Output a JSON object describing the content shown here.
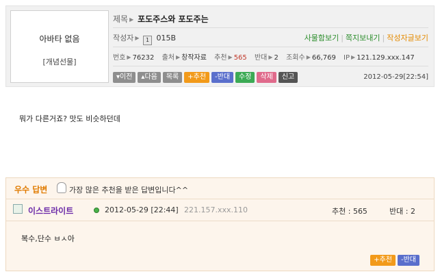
{
  "author_box": {
    "nickname": "아바타 없음",
    "tag": "[개념선물]"
  },
  "post": {
    "title_label": "제목",
    "title": "포도주스와 포도주는",
    "author_label": "작성자",
    "level_icon": "level-icon",
    "author_id": "015B",
    "links": [
      "사물함보기",
      "쪽지보내기",
      "작성자글보기"
    ],
    "meta": {
      "number_label": "번호",
      "number": "76232",
      "source_label": "출처",
      "source": "창작자료",
      "recommend_label": "추천",
      "recommend": "565",
      "oppose_label": "반대",
      "oppose": "2",
      "views_label": "조회수",
      "views": "66,769",
      "ip_label": "IP",
      "ip": "121.129.xxx.147"
    },
    "buttons": {
      "prev": "▾이전",
      "next": "▴다음",
      "list": "목록",
      "recommend": "+추천",
      "oppose": "-반대",
      "edit": "수정",
      "delete": "삭제",
      "report": "신고"
    },
    "datetime": "2012-05-29[22:54]",
    "body": "뭐가 다른거죠? 맛도 비슷하던데"
  },
  "best_answer": {
    "title": "우수 답변",
    "icon": "thumbs-up-icon",
    "description": "가장 많은 추천을 받은 답변입니다^^",
    "user_name": "이스트라이트",
    "datetime": "2012-05-29 [22:44]",
    "ip": "221.157.xxx.110",
    "recommend_text": "추천 : 565",
    "oppose_text": "반대 : 2",
    "content": "복수,단수 ㅂㅅ아",
    "recommend_button": "+추천",
    "oppose_button": "-반대"
  },
  "colors": {
    "header_bg": "#f1f1f1",
    "answer_bg": "#fdf5ec",
    "answer_title": "#e07b00",
    "user_name": "#6b2aa8",
    "link_green": "#2b8d2b",
    "link_orange": "#e48a00",
    "recommend_orange": "#f29a1a",
    "oppose_blue": "#5a6fcc"
  }
}
